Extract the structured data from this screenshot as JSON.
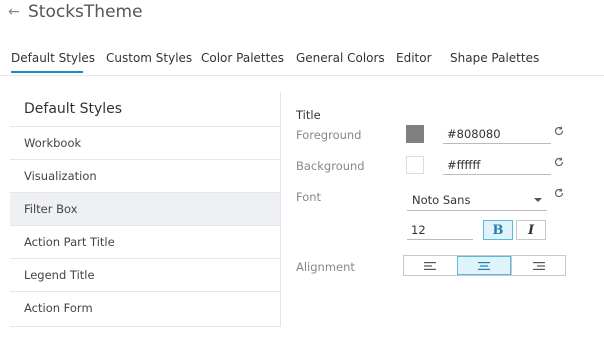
{
  "header": {
    "title": "StocksTheme"
  },
  "tabs": [
    {
      "label": "Default Styles",
      "active": true
    },
    {
      "label": "Custom Styles"
    },
    {
      "label": "Color Palettes"
    },
    {
      "label": "General Colors"
    },
    {
      "label": "Editor"
    },
    {
      "label": "Shape Palettes"
    }
  ],
  "sidebar": {
    "heading": "Default Styles",
    "items": [
      {
        "label": "Workbook"
      },
      {
        "label": "Visualization"
      },
      {
        "label": "Filter Box",
        "selected": true
      },
      {
        "label": "Action Part Title"
      },
      {
        "label": "Legend Title"
      },
      {
        "label": "Action Form"
      }
    ]
  },
  "form": {
    "section_title": "Title",
    "foreground": {
      "label": "Foreground",
      "value": "#808080",
      "swatch": "#808080"
    },
    "background": {
      "label": "Background",
      "value": "#ffffff",
      "swatch": "#ffffff"
    },
    "font": {
      "label": "Font",
      "value": "Noto Sans"
    },
    "size": {
      "value": "12"
    },
    "bold": {
      "label": "B",
      "active": true
    },
    "italic": {
      "label": "I",
      "active": false
    },
    "alignment": {
      "label": "Alignment",
      "options": [
        "left",
        "center",
        "right"
      ],
      "selected": "center"
    }
  },
  "colors": {
    "accent": "#1a8fc6",
    "selected_row": "#eef0f4",
    "active_button": "#dff3fb"
  }
}
